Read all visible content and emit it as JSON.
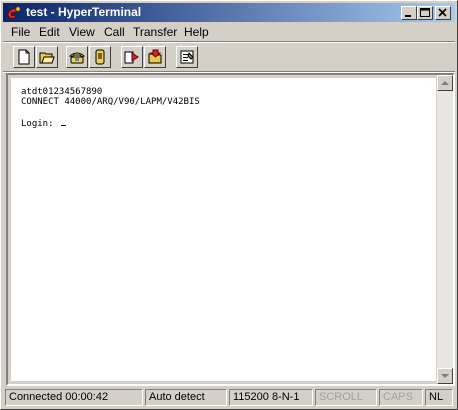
{
  "window": {
    "title": "test - HyperTerminal",
    "icon": "hyperterminal-phone-icon"
  },
  "menu": [
    "File",
    "Edit",
    "View",
    "Call",
    "Transfer",
    "Help"
  ],
  "toolbar": {
    "buttons": [
      "new-icon",
      "open-icon",
      "call-icon",
      "disconnect-icon",
      "send-icon",
      "receive-icon",
      "properties-icon"
    ]
  },
  "terminal": {
    "lines": [
      "atdt01234567890",
      "CONNECT 44000/ARQ/V90/LAPM/V42BIS",
      "",
      "Login: "
    ]
  },
  "status": {
    "connected": "Connected 00:00:42",
    "detect": "Auto detect",
    "settings": "115200 8-N-1",
    "scroll": "SCROLL",
    "caps": "CAPS",
    "num": "NL"
  },
  "colors": {
    "title_start": "#0a246a",
    "title_end": "#a6caf0",
    "face": "#d4d0c8"
  }
}
